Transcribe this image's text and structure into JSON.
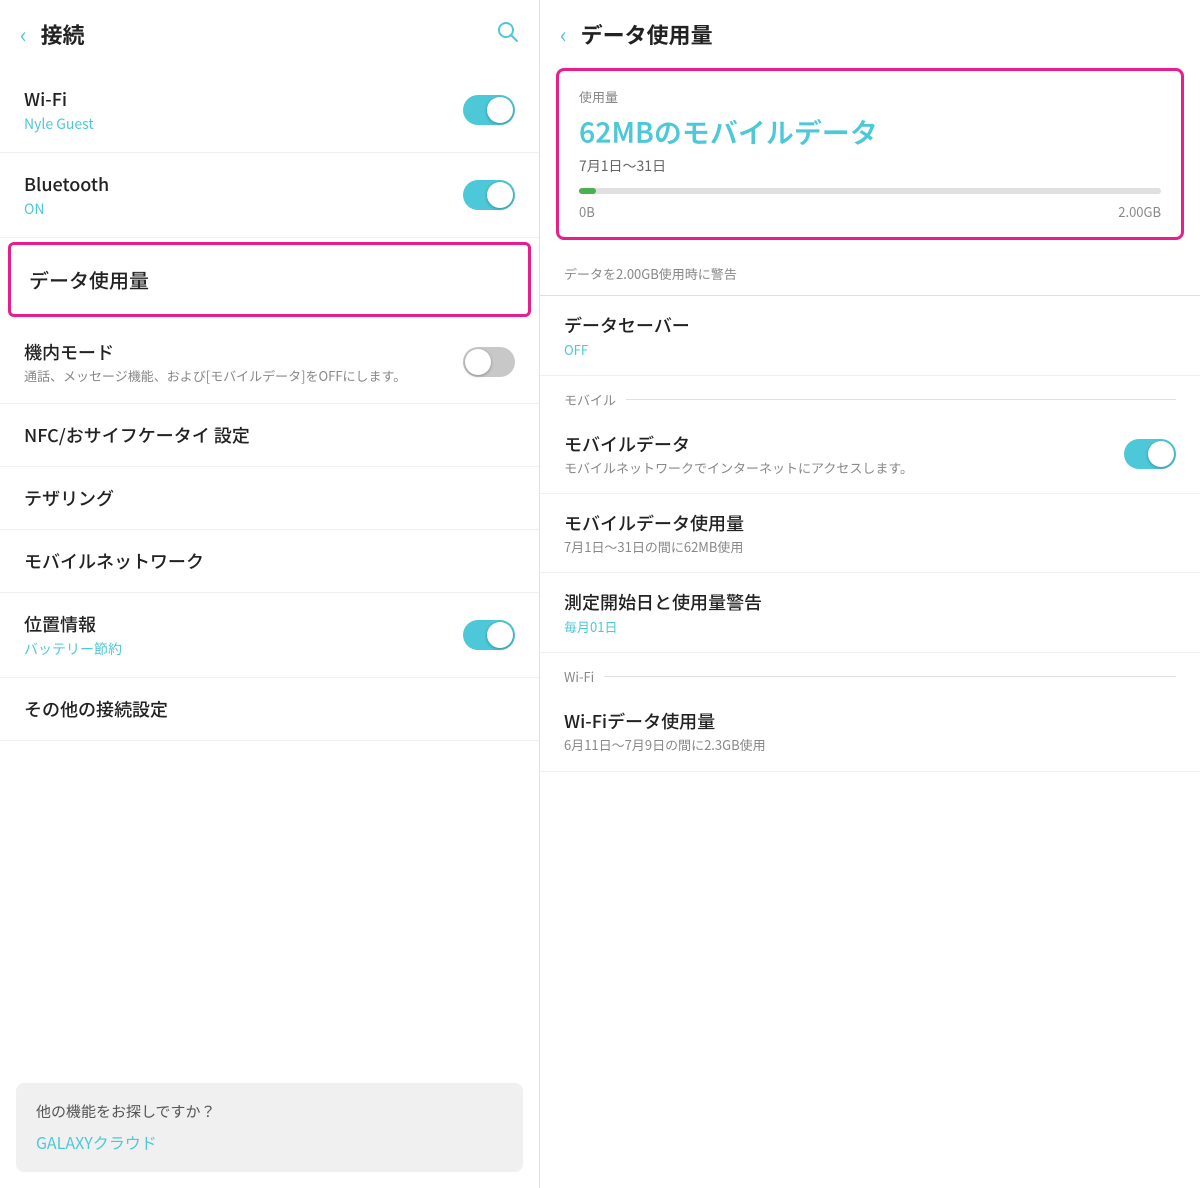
{
  "left": {
    "header": {
      "back_icon": "‹",
      "title": "接続",
      "search_icon": "🔍"
    },
    "items": [
      {
        "id": "wifi",
        "title": "Wi-Fi",
        "sub": "Nyle Guest",
        "toggle": "on",
        "has_toggle": true
      },
      {
        "id": "bluetooth",
        "title": "Bluetooth",
        "sub": "ON",
        "toggle": "on",
        "has_toggle": true
      },
      {
        "id": "data-usage",
        "title": "データ使用量",
        "highlighted": true,
        "has_toggle": false
      },
      {
        "id": "airplane",
        "title": "機内モード",
        "desc": "通話、メッセージ機能、および[モバイルデータ]をOFFにします。",
        "toggle": "off",
        "has_toggle": true
      },
      {
        "id": "nfc",
        "title": "NFC/おサイフケータイ 設定",
        "has_toggle": false
      },
      {
        "id": "tethering",
        "title": "テザリング",
        "has_toggle": false
      },
      {
        "id": "mobile-network",
        "title": "モバイルネットワーク",
        "has_toggle": false
      },
      {
        "id": "location",
        "title": "位置情報",
        "sub": "バッテリー節約",
        "toggle": "on",
        "has_toggle": true
      },
      {
        "id": "other",
        "title": "その他の接続設定",
        "has_toggle": false
      }
    ],
    "suggestion": {
      "title": "他の機能をお探しですか？",
      "link": "GALAXYクラウド"
    }
  },
  "right": {
    "header": {
      "back_icon": "‹",
      "title": "データ使用量"
    },
    "card": {
      "label": "使用量",
      "amount": "62MBのモバイルデータ",
      "period": "7月1日〜31日",
      "progress_percent": 3,
      "range_start": "0B",
      "range_end": "2.00GB"
    },
    "warning": "データを2.00GB使用時に警告",
    "items": [
      {
        "id": "data-saver",
        "title": "データセーバー",
        "sub": "OFF",
        "has_toggle": false
      }
    ],
    "mobile_section": {
      "label": "モバイル",
      "items": [
        {
          "id": "mobile-data",
          "title": "モバイルデータ",
          "desc": "モバイルネットワークでインターネットにアクセスします。",
          "toggle": "on",
          "has_toggle": true
        },
        {
          "id": "mobile-data-usage",
          "title": "モバイルデータ使用量",
          "desc": "7月1日〜31日の間に62MB使用",
          "has_toggle": false
        },
        {
          "id": "measurement",
          "title": "測定開始日と使用量警告",
          "sub": "毎月01日",
          "has_toggle": false
        }
      ]
    },
    "wifi_section": {
      "label": "Wi-Fi",
      "items": [
        {
          "id": "wifi-data-usage",
          "title": "Wi-Fiデータ使用量",
          "desc": "6月11日〜7月9日の間に2.3GB使用",
          "has_toggle": false
        }
      ]
    }
  }
}
